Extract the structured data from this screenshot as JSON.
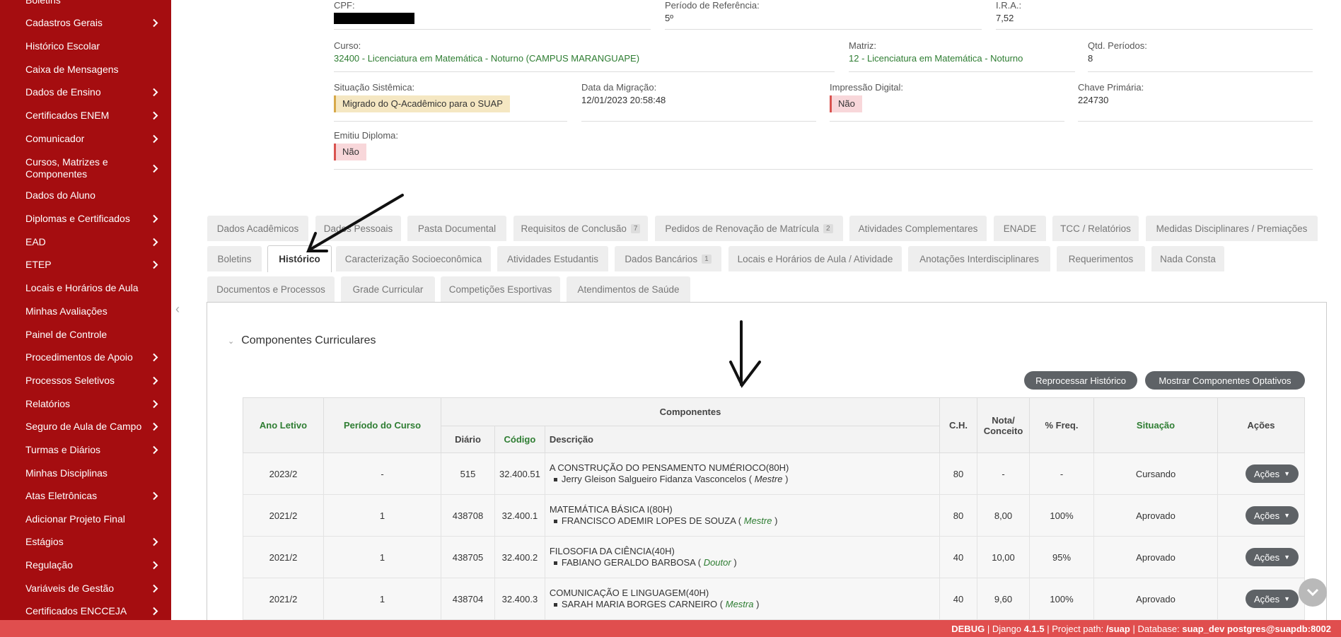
{
  "sidebar": {
    "items": [
      {
        "label": "Boletins",
        "has_children": false
      },
      {
        "label": "Cadastros Gerais",
        "has_children": true
      },
      {
        "label": "Histórico Escolar",
        "has_children": false
      },
      {
        "label": "Caixa de Mensagens",
        "has_children": false
      },
      {
        "label": "Dados de Ensino",
        "has_children": true
      },
      {
        "label": "Certificados ENEM",
        "has_children": true
      },
      {
        "label": "Comunicador",
        "has_children": true
      },
      {
        "label": "Cursos, Matrizes e Componentes",
        "has_children": true
      },
      {
        "label": "Dados do Aluno",
        "has_children": false
      },
      {
        "label": "Diplomas e Certificados",
        "has_children": true
      },
      {
        "label": "EAD",
        "has_children": true
      },
      {
        "label": "ETEP",
        "has_children": true
      },
      {
        "label": "Locais e Horários de Aula",
        "has_children": false
      },
      {
        "label": "Minhas Avaliações",
        "has_children": false
      },
      {
        "label": "Painel de Controle",
        "has_children": false
      },
      {
        "label": "Procedimentos de Apoio",
        "has_children": true
      },
      {
        "label": "Processos Seletivos",
        "has_children": true
      },
      {
        "label": "Relatórios",
        "has_children": true
      },
      {
        "label": "Seguro de Aula de Campo",
        "has_children": true
      },
      {
        "label": "Turmas e Diários",
        "has_children": true
      },
      {
        "label": "Minhas Disciplinas",
        "has_children": false
      },
      {
        "label": "Atas Eletrônicas",
        "has_children": true
      },
      {
        "label": "Adicionar Projeto Final",
        "has_children": false
      },
      {
        "label": "Estágios",
        "has_children": true
      },
      {
        "label": "Regulação",
        "has_children": true
      },
      {
        "label": "Variáveis de Gestão",
        "has_children": true
      },
      {
        "label": "Certificados ENCCEJA",
        "has_children": true
      }
    ]
  },
  "info": {
    "cpf": {
      "label": "CPF:"
    },
    "periodo_ref": {
      "label": "Período de Referência:",
      "value": "5º"
    },
    "ira": {
      "label": "I.R.A.:",
      "value": "7,52"
    },
    "curso": {
      "label": "Curso:",
      "value": "32400 - Licenciatura em Matemática - Noturno (CAMPUS MARANGUAPE)"
    },
    "matriz": {
      "label": "Matriz:",
      "value": "12 - Licenciatura em Matemática - Noturno"
    },
    "qtd_periodos": {
      "label": "Qtd. Períodos:",
      "value": "8"
    },
    "situacao": {
      "label": "Situação Sistêmica:",
      "value": "Migrado do Q-Acadêmico para o SUAP"
    },
    "data_migracao": {
      "label": "Data da Migração:",
      "value": "12/01/2023 20:58:48"
    },
    "impressao": {
      "label": "Impressão Digital:",
      "value": "Não"
    },
    "chave": {
      "label": "Chave Primária:",
      "value": "224730"
    },
    "diploma": {
      "label": "Emitiu Diploma:",
      "value": "Não"
    }
  },
  "tabs": {
    "row1": [
      {
        "label": "Dados Acadêmicos"
      },
      {
        "label": "Dados Pessoais"
      },
      {
        "label": "Pasta Documental"
      },
      {
        "label": "Requisitos de Conclusão",
        "count": "7"
      },
      {
        "label": "Pedidos de Renovação de Matrícula",
        "count": "2"
      },
      {
        "label": "Atividades Complementares"
      },
      {
        "label": "ENADE"
      },
      {
        "label": "TCC / Relatórios"
      },
      {
        "label": "Medidas Disciplinares / Premiações"
      }
    ],
    "row2": [
      {
        "label": "Boletins"
      },
      {
        "label": "Histórico"
      },
      {
        "label": "Caracterização Socioeconômica"
      },
      {
        "label": "Atividades Estudantis"
      },
      {
        "label": "Dados Bancários",
        "count": "1"
      },
      {
        "label": "Locais e Horários de Aula / Atividade"
      },
      {
        "label": "Anotações Interdisciplinares"
      },
      {
        "label": "Requerimentos"
      },
      {
        "label": "Nada Consta"
      }
    ],
    "row3": [
      {
        "label": "Documentos e Processos"
      },
      {
        "label": "Grade Curricular"
      },
      {
        "label": "Competições Esportivas"
      },
      {
        "label": "Atendimentos de Saúde"
      }
    ]
  },
  "section": {
    "title": "Componentes Curriculares",
    "btn_reprocessar": "Reprocessar Histórico",
    "btn_optativos": "Mostrar Componentes Optativos"
  },
  "table": {
    "headers": {
      "ano": "Ano Letivo",
      "periodo": "Período do Curso",
      "componentes": "Componentes",
      "diario": "Diário",
      "codigo": "Código",
      "descricao": "Descrição",
      "ch": "C.H.",
      "nota": "Nota/ Conceito",
      "freq": "% Freq.",
      "situacao": "Situação",
      "acoes": "Ações"
    },
    "rows": [
      {
        "ano": "2023/2",
        "periodo": "-",
        "diario": "515",
        "codigo": "32.400.51",
        "descricao": "A CONSTRUÇÃO DO PENSAMENTO NUMÉRIOCO(80H)",
        "professor": "Jerry Gleison Salgueiro Fidanza Vasconcelos",
        "titulacao": "Mestre",
        "ch": "80",
        "nota": "-",
        "freq": "-",
        "situacao": "Cursando",
        "acoes": "Ações"
      },
      {
        "ano": "2021/2",
        "periodo": "1",
        "diario": "438708",
        "codigo": "32.400.1",
        "descricao": "MATEMÁTICA BÁSICA I(80H)",
        "professor": "FRANCISCO ADEMIR LOPES DE SOUZA",
        "titulacao": "Mestre",
        "ch": "80",
        "nota": "8,00",
        "freq": "100%",
        "situacao": "Aprovado",
        "acoes": "Ações"
      },
      {
        "ano": "2021/2",
        "periodo": "1",
        "diario": "438705",
        "codigo": "32.400.2",
        "descricao": "FILOSOFIA DA CIÊNCIA(40H)",
        "professor": "FABIANO GERALDO BARBOSA",
        "titulacao": "Doutor",
        "ch": "40",
        "nota": "10,00",
        "freq": "95%",
        "situacao": "Aprovado",
        "acoes": "Ações"
      },
      {
        "ano": "2021/2",
        "periodo": "1",
        "diario": "438704",
        "codigo": "32.400.3",
        "descricao": "COMUNICAÇÃO E LINGUAGEM(40H)",
        "professor": "SARAH MARIA BORGES CARNEIRO",
        "titulacao": "Mestra",
        "ch": "40",
        "nota": "9,60",
        "freq": "100%",
        "situacao": "Aprovado",
        "acoes": "Ações"
      }
    ]
  },
  "debug": {
    "debug": "DEBUG",
    "django_label": "Django",
    "django_version": "4.1.5",
    "path_label": "Project path:",
    "path": "/suap",
    "db_label": "Database:",
    "db": "suap_dev postgres@suapdb:8002",
    "sep": "|"
  },
  "colors": {
    "sidebar": "#a50d10",
    "accent_green": "#2e7d32",
    "debug_bar": "#e04e4e"
  }
}
